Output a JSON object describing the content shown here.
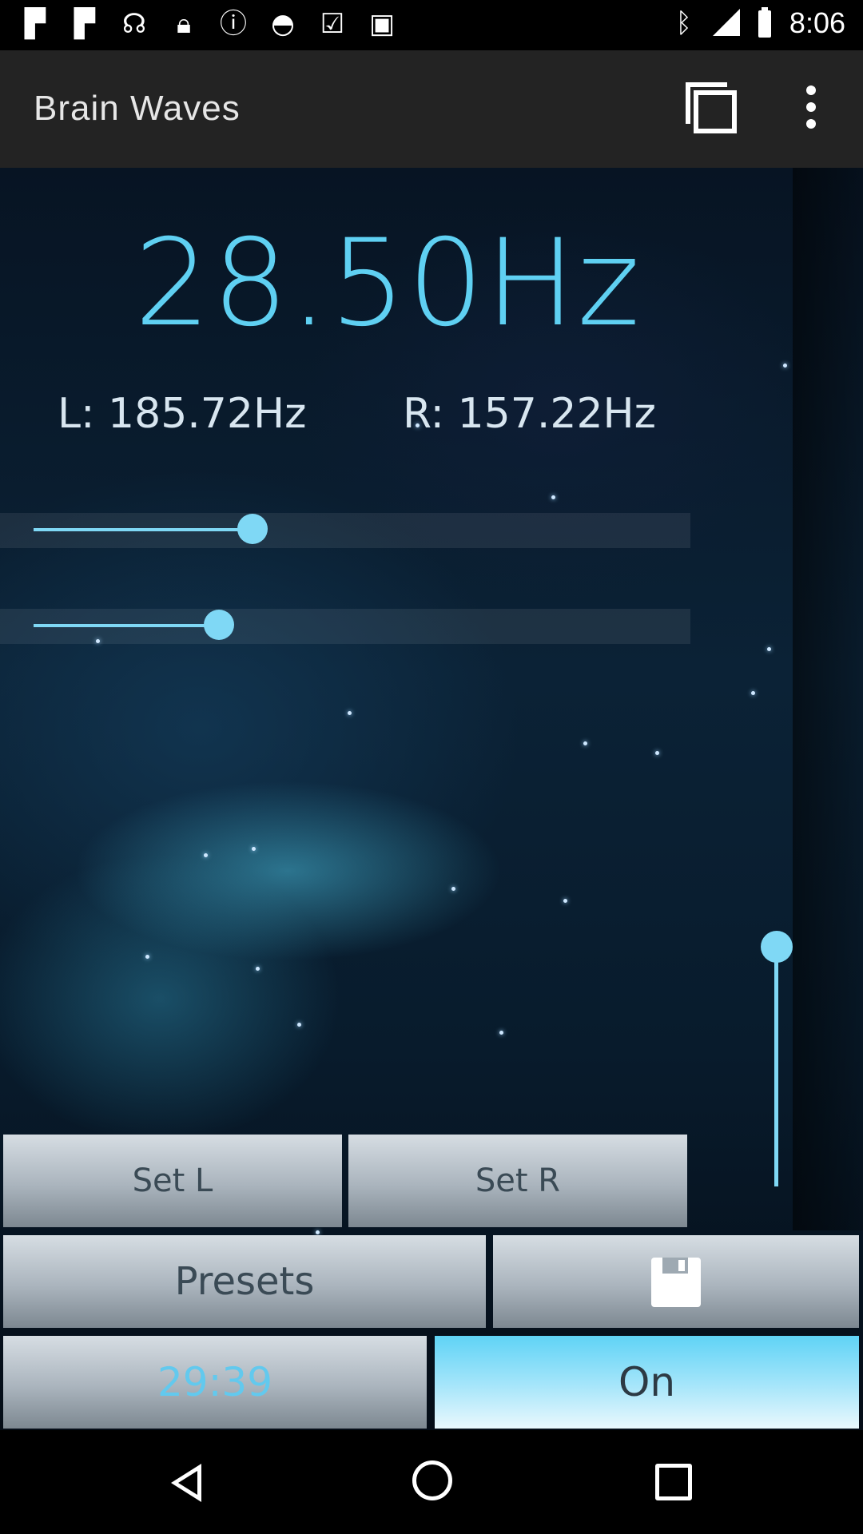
{
  "status_bar": {
    "time": "8:06",
    "left_icons": [
      "flipboard-icon",
      "flipboard-icon",
      "headphones-icon",
      "lock-icon",
      "info-icon",
      "android-icon",
      "check-bag-icon",
      "bag-icon"
    ],
    "right_icons": [
      "bluetooth-icon",
      "signal-icon",
      "battery-icon"
    ]
  },
  "app_bar": {
    "title": "Brain Waves",
    "window_icon": "window-icon",
    "menu_icon": "more-vert-icon"
  },
  "display": {
    "beat_frequency": "28.50Hz",
    "left_frequency": "L: 185.72Hz",
    "right_frequency": "R: 157.22Hz"
  },
  "sliders": {
    "left_position": 0.3,
    "right_position": 0.25,
    "volume_level": 1.0
  },
  "buttons": {
    "set_left": "Set L",
    "set_right": "Set R",
    "presets": "Presets",
    "save_icon": "save-icon",
    "timer": "29:39",
    "power": "On"
  },
  "colors": {
    "accent": "#5fd0f2",
    "app_bar": "#232323"
  },
  "nav_bar": {
    "icons": [
      "back-icon",
      "home-icon",
      "recent-apps-icon"
    ]
  }
}
